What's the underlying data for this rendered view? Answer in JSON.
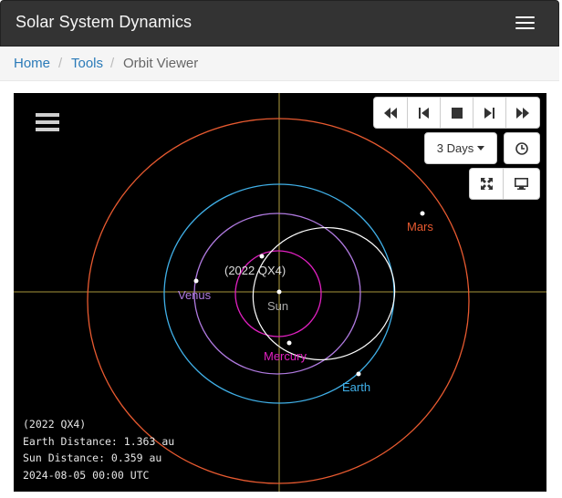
{
  "navbar": {
    "brand": "Solar System Dynamics"
  },
  "breadcrumb": {
    "home": "Home",
    "tools": "Tools",
    "current": "Orbit Viewer"
  },
  "controls": {
    "step_label": "3 Days"
  },
  "labels": {
    "object": "(2022 QX4)",
    "sun": "Sun",
    "mercury": "Mercury",
    "venus": "Venus",
    "earth": "Earth",
    "mars": "Mars"
  },
  "colors": {
    "mercury": "#e020c0",
    "venus": "#b07ae0",
    "earth": "#40b0e8",
    "mars": "#e85a30",
    "object": "#ffffff",
    "axes": "#e0c850"
  },
  "info": {
    "object": "(2022 QX4)",
    "earth_distance": "Earth Distance: 1.363 au",
    "sun_distance": "Sun Distance: 0.359 au",
    "datetime": "2024-08-05 00:00 UTC"
  },
  "icons": [
    "rewind-icon",
    "step-back-icon",
    "stop-icon",
    "step-forward-icon",
    "fast-forward-icon",
    "clock-icon",
    "expand-icon",
    "monitor-icon",
    "menu-icon"
  ]
}
